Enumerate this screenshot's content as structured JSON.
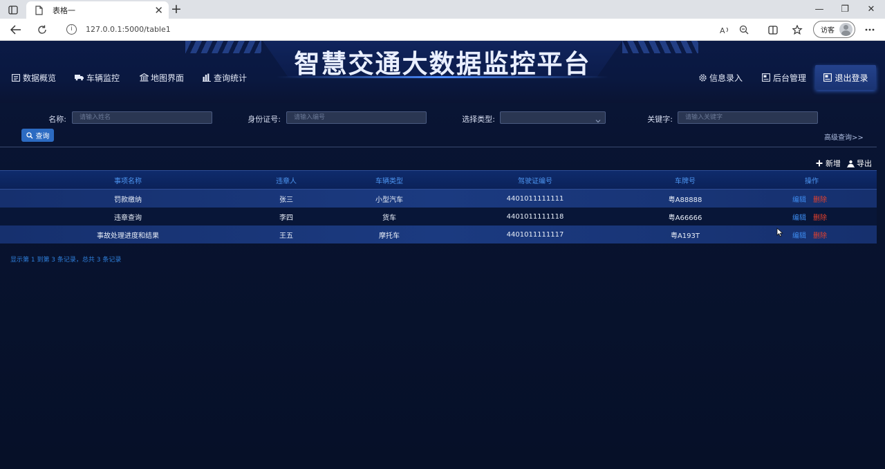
{
  "browser": {
    "tab_title": "表格一",
    "close_glyph": "✕",
    "newtab_glyph": "+",
    "url": "127.0.0.1:5000/table1",
    "profile_label": "访客",
    "window_controls": [
      "—",
      "❐",
      "✕"
    ]
  },
  "app": {
    "title": "智慧交通大数据监控平台",
    "nav_left": [
      {
        "label": "数据概览",
        "icon": "list-icon"
      },
      {
        "label": "车辆监控",
        "icon": "truck-icon"
      },
      {
        "label": "地图界面",
        "icon": "bank-icon"
      },
      {
        "label": "查询统计",
        "icon": "bar-chart-icon"
      }
    ],
    "nav_right": [
      {
        "label": "信息录入",
        "icon": "gear-icon"
      },
      {
        "label": "后台管理",
        "icon": "panel-icon"
      },
      {
        "label": "退出登录",
        "icon": "logout-icon"
      }
    ]
  },
  "filters": {
    "name_label": "名称:",
    "name_placeholder": "请输入姓名",
    "id_label": "身份证号:",
    "id_placeholder": "请输入编号",
    "type_label": "选择类型:",
    "type_value": "",
    "keyword_label": "关键字:",
    "keyword_placeholder": "请输入关键字",
    "query_button": "查询",
    "advanced": "高级查询>>"
  },
  "toolbar": {
    "add_label": "新增",
    "export_label": "导出"
  },
  "table": {
    "headers": [
      "事项名称",
      "违章人",
      "车辆类型",
      "驾驶证编号",
      "车牌号",
      "操作"
    ],
    "rows": [
      [
        "罚款缴纳",
        "张三",
        "小型汽车",
        "4401011111111",
        "粤A88888"
      ],
      [
        "违章查询",
        "李四",
        "货车",
        "4401011111118",
        "粤A66666"
      ],
      [
        "事故处理进度和结果",
        "王五",
        "摩托车",
        "4401011111117",
        "粤A193T"
      ]
    ],
    "edit_label": "编辑",
    "delete_label": "删除",
    "footer": "显示第 1 到第 3 条记录，总共 3 条记录"
  },
  "colors": {
    "accent": "#2c6bc2",
    "header_text": "#4d95f0",
    "delete": "#e5412d",
    "background": "#07122f"
  }
}
